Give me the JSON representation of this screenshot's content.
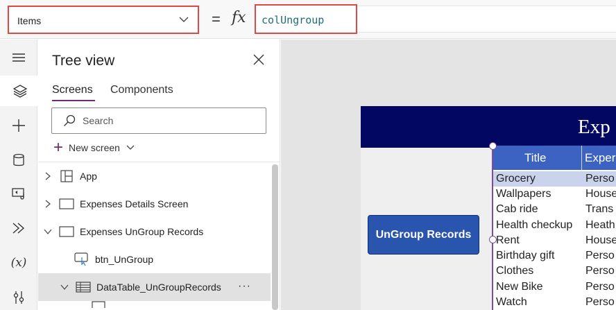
{
  "formula_bar": {
    "property": "Items",
    "equals": "=",
    "fx": "fx",
    "formula": "colUngroup"
  },
  "rail": {
    "items": [
      "menu-icon",
      "layers-icon",
      "plus-icon",
      "database-icon",
      "media-icon",
      "flow-icon",
      "variables-icon",
      "tools-icon"
    ],
    "variables_label": "(x)"
  },
  "tree": {
    "title": "Tree view",
    "tabs": [
      "Screens",
      "Components"
    ],
    "search_placeholder": "Search",
    "new_screen": "New screen",
    "nodes": [
      {
        "label": "App"
      },
      {
        "label": "Expenses Details Screen"
      },
      {
        "label": "Expenses UnGroup Records"
      },
      {
        "label": "btn_UnGroup"
      },
      {
        "label": "DataTable_UnGroupRecords",
        "more": "···"
      }
    ]
  },
  "canvas": {
    "header_text": "Exp",
    "button_label": "UnGroup Records",
    "table": {
      "columns": [
        "Title",
        "Exper"
      ],
      "rows": [
        [
          "Grocery",
          "Perso"
        ],
        [
          "Wallpapers",
          "House"
        ],
        [
          "Cab ride",
          "Trans"
        ],
        [
          "Health checkup",
          "Heath"
        ],
        [
          "Rent",
          "House"
        ],
        [
          "Birthday gift",
          "Perso"
        ],
        [
          "Clothes",
          "Perso"
        ],
        [
          "New Bike",
          "Perso"
        ],
        [
          "Watch",
          "Perso"
        ]
      ]
    }
  },
  "colors": {
    "highlight_border": "#e04848",
    "accent": "#742774",
    "header_bg": "#020761",
    "button_bg": "#2a55ae",
    "table_header_bg": "#3c63c2"
  }
}
